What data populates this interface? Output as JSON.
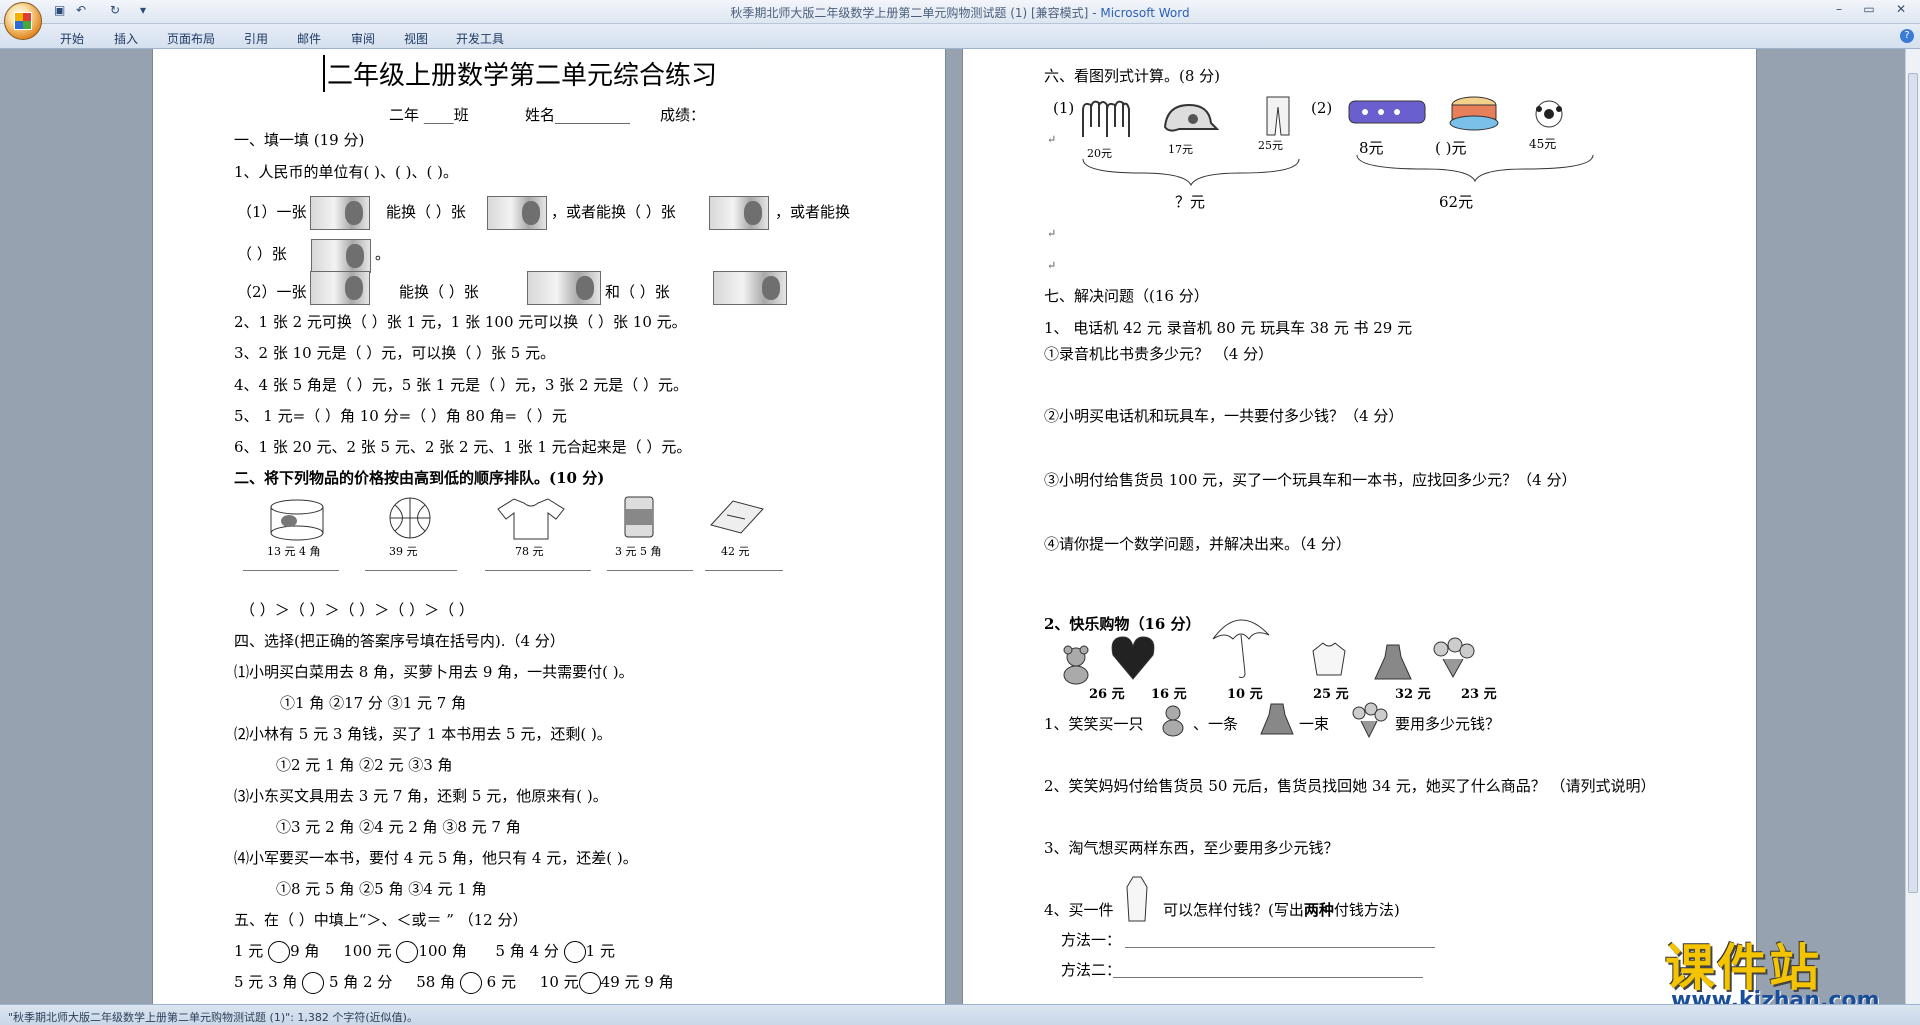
{
  "window": {
    "title": "秋季期北师大版二年级数学上册第二单元购物测试题 (1) [兼容模式]",
    "title_sep": " - ",
    "app_name": "Microsoft Word",
    "qat_save": "▣",
    "qat_undo": "↶",
    "qat_redo": "↻",
    "qat_more": "▾",
    "minimize": "–",
    "maximize": "▭",
    "close": "✕"
  },
  "ribbon": {
    "tabs": [
      "开始",
      "插入",
      "页面布局",
      "引用",
      "邮件",
      "审阅",
      "视图",
      "开发工具"
    ],
    "help": "?"
  },
  "status": {
    "text": "\"秋季期北师大版二年级数学上册第二单元购物测试题 (1)\": 1,382 个字符(近似值)。"
  },
  "watermark": {
    "cn": "课件站",
    "url": "www.kjzhan.com"
  },
  "page1": {
    "title": "二年级上册数学第二单元综合练习",
    "header_class": "二年 ____班",
    "header_name": "姓名__________",
    "header_score": "成绩：",
    "s1": "一、填一填 (19 分)",
    "q1": "1、人民币的单位有(        )、(        )、(        )。",
    "q1a_1": "（1）一张",
    "q1a_2": "能换（    ）张",
    "q1a_3": "，或者能换（    ）张",
    "q1a_4": "，或者能换",
    "q1b_1": "（    ）张",
    "q1b_2": "。",
    "q1c_1": "（2）一张",
    "q1c_2": "能换（    ）张",
    "q1c_3": "和（    ）张",
    "q2": "2、1 张 2 元可换（    ）张 1 元，1 张 100 元可以换（    ）张 10 元。",
    "q3": "3、2 张 10 元是（      ）元，可以换（        ）张 5 元。",
    "q4": "4、4 张 5 角是（      ）元，5 张 1 元是（      ）元，3 张 2 元是（     ）元。",
    "q5": "5、    1 元=（   ）角        10 分=（   ）角         80 角=（   ）元",
    "q6": "6、1 张 20 元、2 张 5 元、2 张 2 元、1 张 1 元合起来是（      ）元。",
    "s2": "二、将下列物品的价格按由高到低的顺序排队。(10 分)",
    "prices": [
      "13 元 4 角",
      "39 元",
      "78 元",
      "3 元 5 角",
      "42 元"
    ],
    "order": "（          ）＞（          ）＞（         ）＞（            ）＞（          ）",
    "s4": "四、选择(把正确的答案序号填在括号内).（4 分）",
    "c1": "⑴小明买白菜用去 8 角，买萝卜用去 9 角，一共需要付(       )。",
    "c1o": "①1 角                 ②17 分                 ③1 元 7 角",
    "c2": "⑵小林有 5 元 3 角钱，买了 1 本书用去 5 元，还剩(       )。",
    "c2o": "①2 元 1 角              ②2 元                   ③3 角",
    "c3": "⑶小东买文具用去 3 元 7 角，还剩 5 元，他原来有(       )。",
    "c3o": "①3 元 2 角              ②4 元 2 角               ③8 元 7 角",
    "c4": "⑷小军要买一本书，要付 4 元 5 角，他只有 4 元，还差(       )。",
    "c4o": "①8 元 5 角              ②5 角                    ③4 元 1 角",
    "s5": "五、在（    ）中填上“＞、＜或＝ ”     （12 分）",
    "r1": [
      "1 元",
      "9 角",
      "100 元",
      "100 角",
      "5 角 4 分",
      "1 元"
    ],
    "r2": [
      "5 元 3 角",
      "5 角 2 分",
      "58 角",
      "6 元",
      "10 元",
      "49 元 9 角"
    ]
  },
  "page2": {
    "s6": "六、看图列式计算。(8 分)",
    "p1_label": "(1)",
    "p2_label": "(2)",
    "g_prices": [
      "20元",
      "17元",
      "25元"
    ],
    "g_sum": "？元",
    "t_prices": [
      "8元",
      "(    )元",
      "45元"
    ],
    "t_sum": "62元",
    "s7": "七、解决问题（(16 分）",
    "items": "1、    电话机 42 元         录音机 80 元         玩具车 38 元         书 29 元",
    "p7_1": "①录音机比书贵多少元？ （4 分）",
    "p7_2": "②小明买电话机和玩具车，一共要付多少钱？（4 分）",
    "p7_3": "③小明付给售货员 100 元，买了一个玩具车和一本书，应找回多少元？（4 分）",
    "p7_4": "④请你提一个数学问题，并解决出来。（4 分）",
    "s_shop": "2、快乐购物（16 分）",
    "shop_prices": [
      "26 元",
      "16 元",
      "10 元",
      "25 元",
      "32 元",
      "23 元"
    ],
    "k1_a": "1、笑笑买一只",
    "k1_b": "、一条",
    "k1_c": "一束",
    "k1_d": "要用多少元钱？",
    "k2": "2、笑笑妈妈付给售货员 50 元后，售货员找回她 34 元，她买了什么商品？ （请列式说明）",
    "k3": "3、淘气想买两样东西，至少要用多少元钱？",
    "k4_a": "4、买一件",
    "k4_b": "可以怎样付钱？(写出",
    "k4_bold": "两种",
    "k4_c": "付钱方法)",
    "m1": "方法一：",
    "m2": "方法二："
  }
}
